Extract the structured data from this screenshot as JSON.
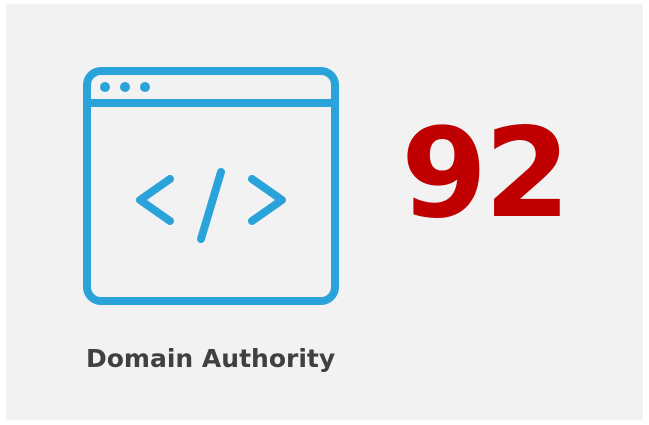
{
  "metric": {
    "value": "92",
    "label": "Domain Authority",
    "icon": "browser-code-icon"
  },
  "colors": {
    "background": "#f2f2f2",
    "value": "#c00000",
    "label": "#404040",
    "icon": "#29a3d9"
  }
}
